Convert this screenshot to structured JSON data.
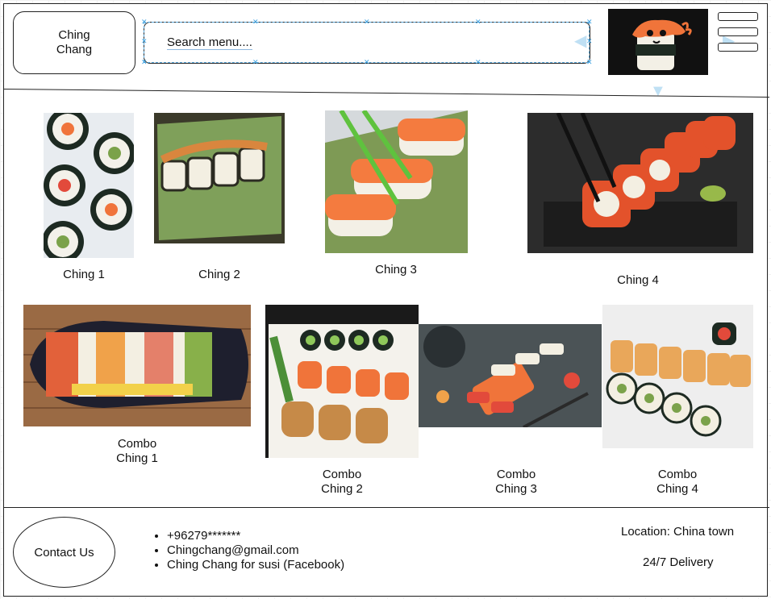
{
  "header": {
    "logo_text": "Ching\nChang",
    "search_placeholder": "Search menu....",
    "avatar_icon": "sushi-mascot-icon",
    "menu_icon": "hamburger-menu-icon"
  },
  "menu": {
    "items": [
      {
        "label": "Ching 1"
      },
      {
        "label": "Ching 2"
      },
      {
        "label": "Ching 3"
      },
      {
        "label": "Ching 4"
      }
    ],
    "combos": [
      {
        "label": "Combo\nChing 1"
      },
      {
        "label": "Combo\nChing 2"
      },
      {
        "label": "Combo\nChing 3"
      },
      {
        "label": "Combo\nChing 4"
      }
    ]
  },
  "footer": {
    "contact_button": "Contact Us",
    "contacts": [
      "+96279*******",
      "Chingchang@gmail.com",
      "Ching Chang for susi (Facebook)"
    ],
    "location": "Location: China town",
    "delivery": "24/7 Delivery"
  },
  "colors": {
    "outline": "#222222",
    "selection": "#3aa0e0",
    "salmon": "#f0743a",
    "rice": "#f5f2ea",
    "nori": "#1d2a22"
  }
}
